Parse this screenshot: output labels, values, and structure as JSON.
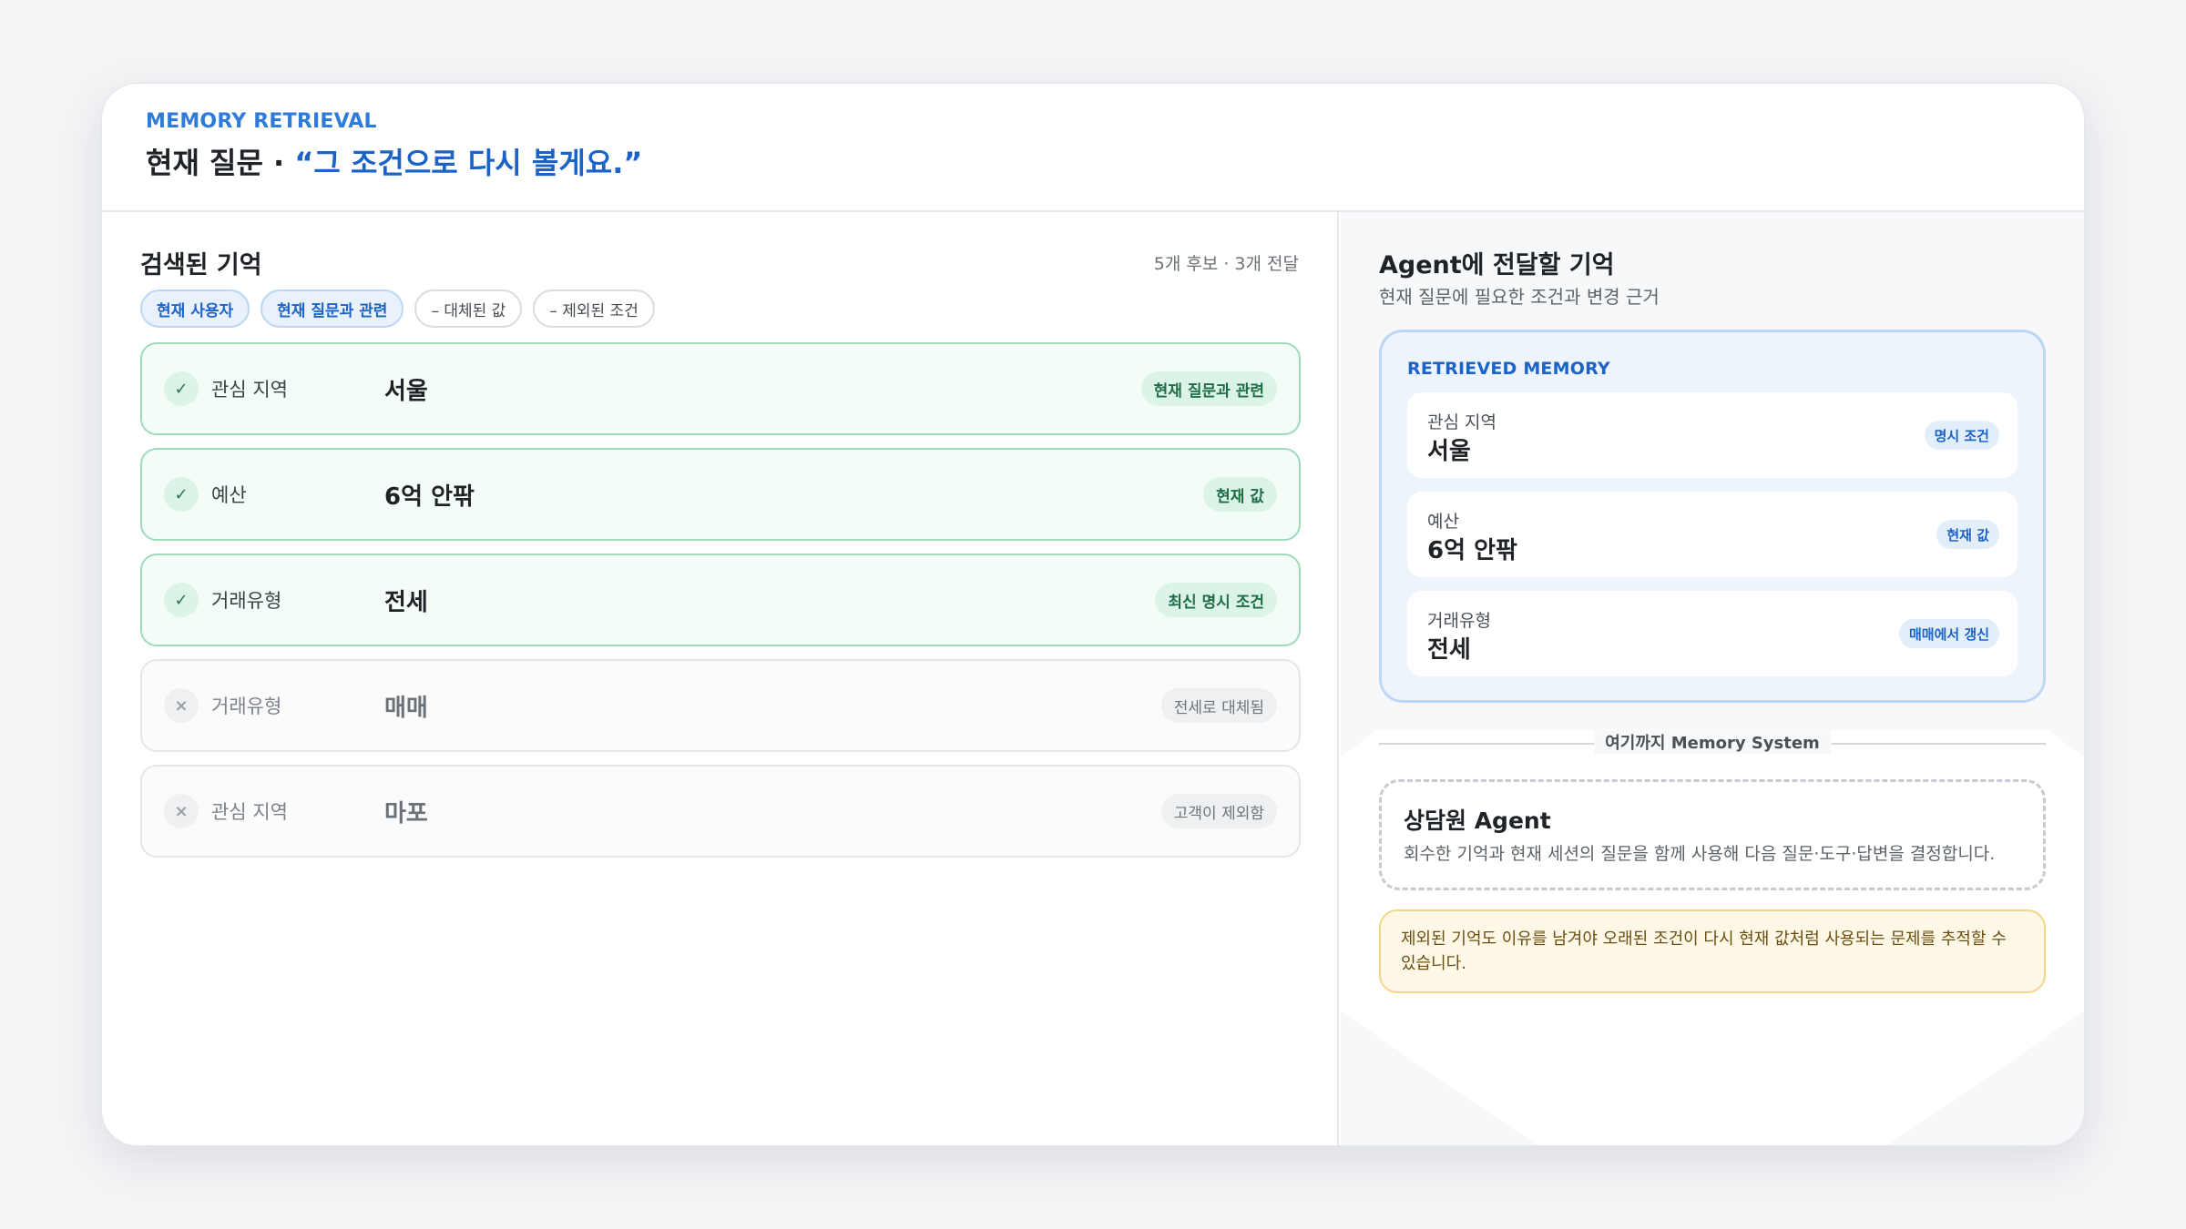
{
  "header": {
    "eyebrow": "MEMORY RETRIEVAL",
    "title_prefix": "현재 질문 · ",
    "title_quote": "“그 조건으로 다시 볼게요.”"
  },
  "left": {
    "title": "검색된 기억",
    "meta": "5개 후보 · 3개 전달",
    "chips": [
      {
        "label": "현재 사용자",
        "active": true
      },
      {
        "label": "현재 질문과 관련",
        "active": true
      },
      {
        "label": "– 대체된 값",
        "active": false
      },
      {
        "label": "– 제외된 조건",
        "active": false
      }
    ],
    "rows": [
      {
        "status": "included",
        "icon": "check-icon",
        "label": "관심 지역",
        "value": "서울",
        "badge": "현재 질문과 관련"
      },
      {
        "status": "included",
        "icon": "check-icon",
        "label": "예산",
        "value": "6억 안팎",
        "badge": "현재 값"
      },
      {
        "status": "included",
        "icon": "check-icon",
        "label": "거래유형",
        "value": "전세",
        "badge": "최신 명시 조건"
      },
      {
        "status": "excluded",
        "icon": "close-icon",
        "label": "거래유형",
        "value": "매매",
        "badge": "전세로 대체됨"
      },
      {
        "status": "excluded",
        "icon": "close-icon",
        "label": "관심 지역",
        "value": "마포",
        "badge": "고객이 제외함"
      }
    ]
  },
  "right": {
    "title": "Agent에 전달할 기억",
    "subtitle": "현재 질문에 필요한 조건과 변경 근거",
    "memory_header": "RETRIEVED MEMORY",
    "memory_items": [
      {
        "label": "관심 지역",
        "value": "서울",
        "badge": "명시 조건"
      },
      {
        "label": "예산",
        "value": "6억 안팎",
        "badge": "현재 값"
      },
      {
        "label": "거래유형",
        "value": "전세",
        "badge": "매매에서 갱신"
      }
    ],
    "divider": "여기까지 Memory System",
    "agent": {
      "title": "상담원 Agent",
      "description": "회수한 기억과 현재 세션의 질문을 함께 사용해 다음 질문·도구·답변을 결정합니다."
    },
    "note": "제외된 기억도 이유를 남겨야 오래된 조건이 다시 현재 값처럼 사용되는 문제를 추적할 수 있습니다."
  },
  "colors": {
    "accent": "#1c63c8",
    "included": "#1e7a4d",
    "excluded": "#9aa0a6",
    "warning_bg": "#fff8e7"
  }
}
